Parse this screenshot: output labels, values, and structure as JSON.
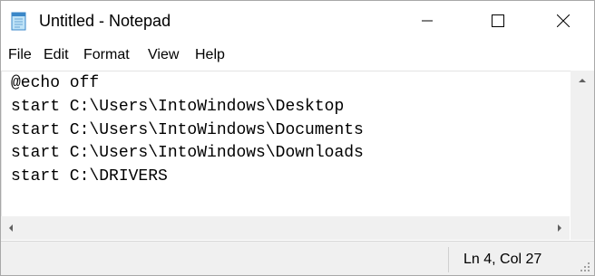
{
  "window": {
    "title": "Untitled - Notepad",
    "icon": "notepad-icon",
    "controls": [
      "minimize-icon",
      "maximize-icon",
      "close-icon"
    ]
  },
  "menu": {
    "file": "File",
    "edit": "Edit",
    "format": "Format",
    "view": "View",
    "help": "Help"
  },
  "editor": {
    "lines": [
      "@echo off",
      "start C:\\Users\\IntoWindows\\Desktop",
      "start C:\\Users\\IntoWindows\\Documents",
      "start C:\\Users\\IntoWindows\\Downloads",
      "start C:\\DRIVERS"
    ]
  },
  "status": {
    "position": "Ln 4, Col 27"
  },
  "colors": {
    "titlebar_bg": "#ffffff",
    "statusbar_bg": "#f0f0f0",
    "text": "#000000"
  }
}
